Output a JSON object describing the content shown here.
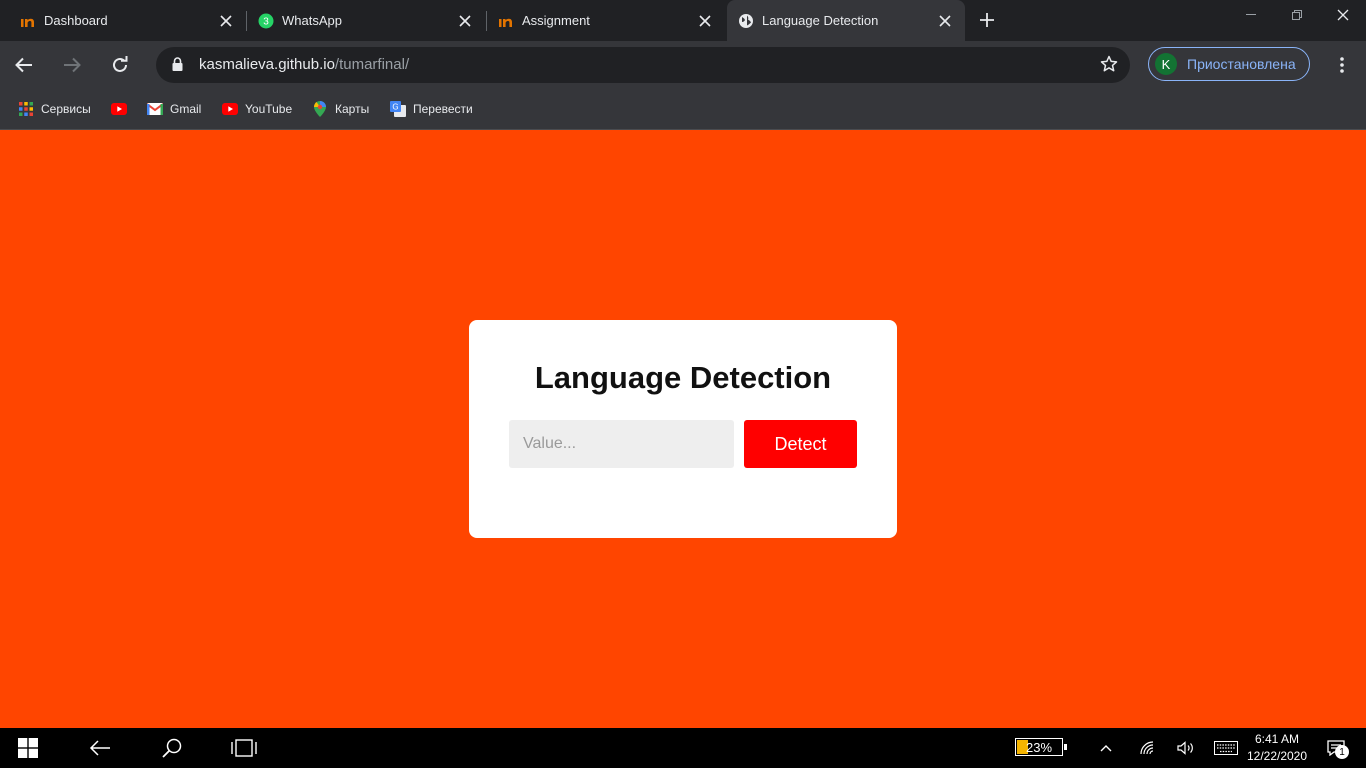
{
  "browser": {
    "tabs": [
      {
        "title": "Dashboard",
        "icon": "brand-in-icon",
        "active": false
      },
      {
        "title": "WhatsApp",
        "icon": "whatsapp-icon",
        "badge": "3",
        "active": false
      },
      {
        "title": "Assignment",
        "icon": "brand-in-icon",
        "active": false
      },
      {
        "title": "Language Detection",
        "icon": "globe-icon",
        "active": true
      }
    ],
    "address": {
      "host": "kasmalieva.github.io",
      "path": "/tumarfinal/"
    },
    "profile": {
      "initial": "K",
      "status": "Приостановлена"
    },
    "bookmarks": [
      {
        "label": "Сервисы",
        "icon": "apps-grid-icon"
      },
      {
        "label": "",
        "icon": "youtube-icon"
      },
      {
        "label": "Gmail",
        "icon": "gmail-icon"
      },
      {
        "label": "YouTube",
        "icon": "youtube-icon"
      },
      {
        "label": "Карты",
        "icon": "maps-pin-icon"
      },
      {
        "label": "Перевести",
        "icon": "translate-icon"
      }
    ]
  },
  "app": {
    "background_color": "#ff4500",
    "title": "Language Detection",
    "input_placeholder": "Value...",
    "input_value": "",
    "detect_label": "Detect",
    "detect_color": "#ff0000"
  },
  "taskbar": {
    "battery_percent": "23%",
    "battery_level": 0.23,
    "time": "6:41 AM",
    "date": "12/22/2020",
    "notification_count": "1"
  }
}
